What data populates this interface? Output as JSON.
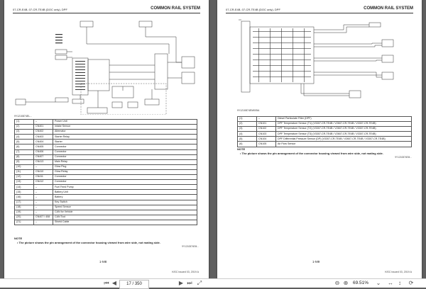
{
  "left": {
    "header_left": "07-CR-E4B, 07-CR-TE4B (DOC only), DPF",
    "header_right": "COMMON RAIL SYSTEM",
    "fig_id": "9Y1210874EL...",
    "legend": [
      [
        "(1)",
        "–",
        "Power Unit"
      ],
      [
        "(2)",
        "CN401",
        "Intake Sensor"
      ],
      [
        "(3)",
        "CN402",
        "Alternator"
      ],
      [
        "(4)",
        "CN403",
        "Starter Relay"
      ],
      [
        "(5)",
        "CN404",
        "Starter"
      ],
      [
        "(6)",
        "CN405",
        "Connector"
      ],
      [
        "(7)",
        "CN406",
        "Connector"
      ],
      [
        "(8)",
        "CN407",
        "Connector"
      ],
      [
        "(9)",
        "CN413",
        "Main Relay"
      ],
      [
        "(10)",
        "–",
        "Glow Plug"
      ],
      [
        "(11)",
        "CN410",
        "Glow Relay"
      ],
      [
        "(12)",
        "CN411",
        "Connector"
      ],
      [
        "(13)",
        "CN412",
        "Connector"
      ],
      [
        "(14)",
        "–",
        "Fuel Feed Pump"
      ],
      [
        "(15)",
        "–",
        "Battery Unit"
      ],
      [
        "(16)",
        "–",
        "Battery"
      ],
      [
        "(17)",
        "–",
        "Key Switch"
      ],
      [
        "(18)",
        "–",
        "Speed Sensor"
      ],
      [
        "(19)",
        "–",
        "CAN for Vehicle"
      ],
      [
        "(20)",
        "CN407 / 408",
        "CAN Tool"
      ],
      [
        "(21)",
        "–",
        "Shield Cable"
      ]
    ],
    "note_title": "NOTE",
    "note_text": "• The picture shows the pin arrangement of the connector housing viewed from wire side, not mating side.",
    "note_ref": "9Y1210874EM...",
    "page_num": "1-M8",
    "footer": "KiSC issued 03, 2019 A"
  },
  "right": {
    "header_left": "07-CR-E4B, 07-CR-TE4B (DOC only), DPF",
    "header_right": "COMMON RAIL SYSTEM",
    "fig_id": "9Y1210874EM005A",
    "legend": [
      [
        "(1)",
        "–",
        "Diesel Particulate Filter (DPF)"
      ],
      [
        "(2)",
        "CN101",
        "DPF Temperature Sensor (T1) (V3307-CR-TE4B / V2607-CR-TE4B / V3307-CR-TE4B)"
      ],
      [
        "(3)",
        "CN102",
        "DPF Temperature Sensor (T2) (V3307-CR-TE4B / V2607-CR-TE4B / V3307-CR-TE4B)"
      ],
      [
        "(4)",
        "CN103",
        "DPF Temperature Sensor (T3) (V3307-CR-TE4B / V2607-CR-TE4B / V3307-CR-TE4B)"
      ],
      [
        "(5)",
        "CN104",
        "DPF Differential Pressure Sensor (DP) (V3307-CR-TE4B / V2607-CR-TE4B / V3307-CR-TE4B)"
      ],
      [
        "(6)",
        "CN105",
        "Air Flow Sensor"
      ]
    ],
    "note_title": "NOTE",
    "note_text": "• The picture shows the pin arrangement of the connector housing viewed from wire side, not mating side.",
    "note_ref": "9Y1210874EM...",
    "page_num": "1-M9",
    "footer": "KiSC issued 03, 2019 A"
  },
  "toolbar": {
    "page_current": "17 / 350",
    "zoom": "69.51%"
  }
}
